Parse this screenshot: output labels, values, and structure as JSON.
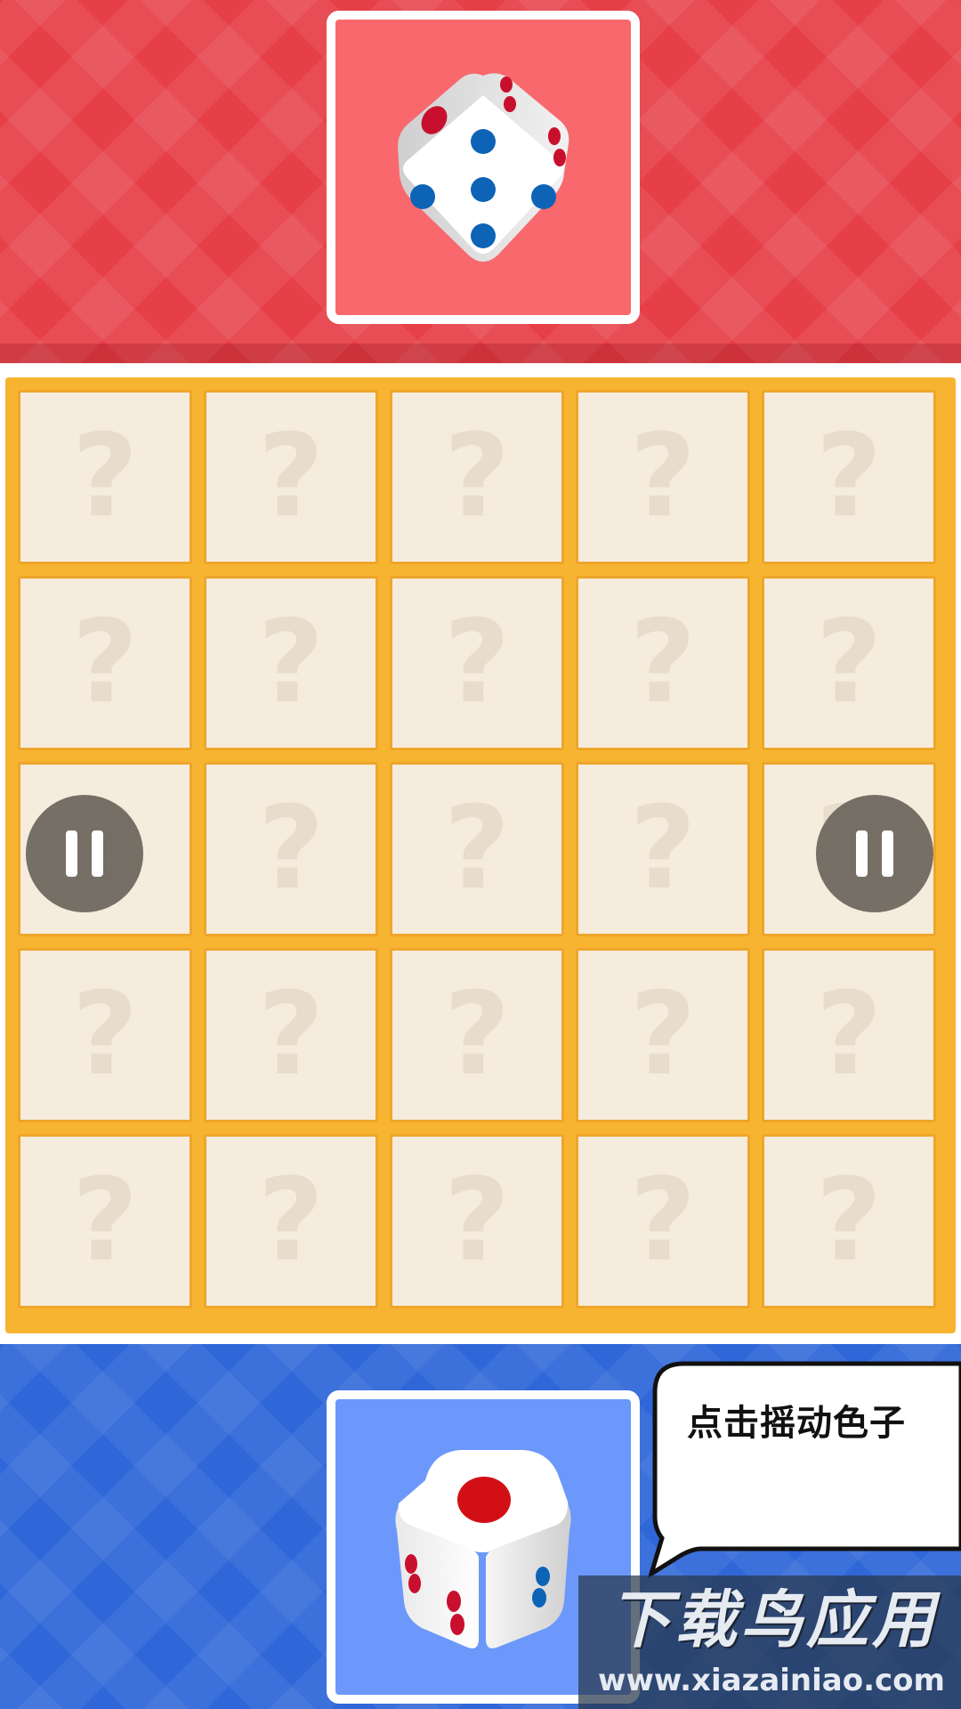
{
  "player_top": {
    "color": "#e63f48",
    "dice_panel_color": "#f9686d",
    "dice_top_face": 5,
    "dice_left_face": 1,
    "dice_right_face": 3
  },
  "player_bottom": {
    "color": "#3067d8",
    "dice_panel_color": "#6c98fb",
    "dice_top_face": 1,
    "dice_left_face": 2,
    "dice_right_face": 2
  },
  "board": {
    "rows": 5,
    "cols": 5,
    "cells": [
      [
        "?",
        "?",
        "?",
        "?",
        "?"
      ],
      [
        "?",
        "?",
        "?",
        "?",
        "?"
      ],
      [
        "?",
        "?",
        "?",
        "?",
        "?"
      ],
      [
        "?",
        "?",
        "?",
        "?",
        "?"
      ],
      [
        "?",
        "?",
        "?",
        "?",
        "?"
      ]
    ]
  },
  "pause_buttons": {
    "left_icon": "pause-icon",
    "right_icon": "pause-icon"
  },
  "speech_bubble": {
    "text": "点击摇动色子"
  },
  "watermark": {
    "title": "下载鸟应用",
    "url": "www.xiazainiao.com"
  }
}
